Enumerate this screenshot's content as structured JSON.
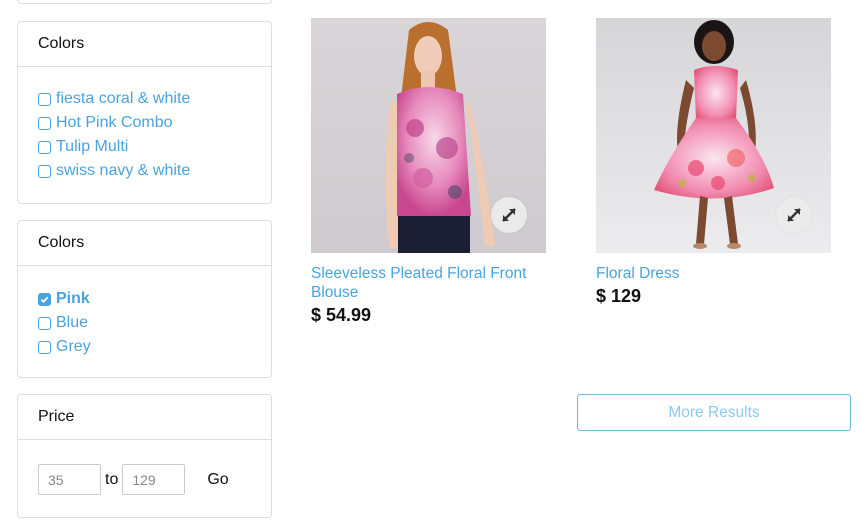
{
  "colors_facet_1": {
    "title": "Colors",
    "items": [
      {
        "label": "fiesta coral & white",
        "checked": false
      },
      {
        "label": "Hot Pink Combo",
        "checked": false
      },
      {
        "label": "Tulip Multi",
        "checked": false
      },
      {
        "label": "swiss navy & white",
        "checked": false
      }
    ]
  },
  "colors_facet_2": {
    "title": "Colors",
    "items": [
      {
        "label": "Pink",
        "checked": true
      },
      {
        "label": "Blue",
        "checked": false
      },
      {
        "label": "Grey",
        "checked": false
      }
    ]
  },
  "price_facet": {
    "title": "Price",
    "min_value": "35",
    "max_value": "129",
    "to_label": "to",
    "go_label": "Go"
  },
  "products": [
    {
      "title": "Sleeveless Pleated Floral Front Blouse",
      "price": "$ 54.99",
      "image": "woman-floral-sleeveless-blouse-photo"
    },
    {
      "title": "Floral Dress",
      "price": "$ 129",
      "image": "woman-floral-dress-photo"
    }
  ],
  "more_results_label": "More Results",
  "colors": {
    "link": "#4aa3df",
    "border": "#dfdfdf",
    "button_border": "#6cb8e6"
  }
}
